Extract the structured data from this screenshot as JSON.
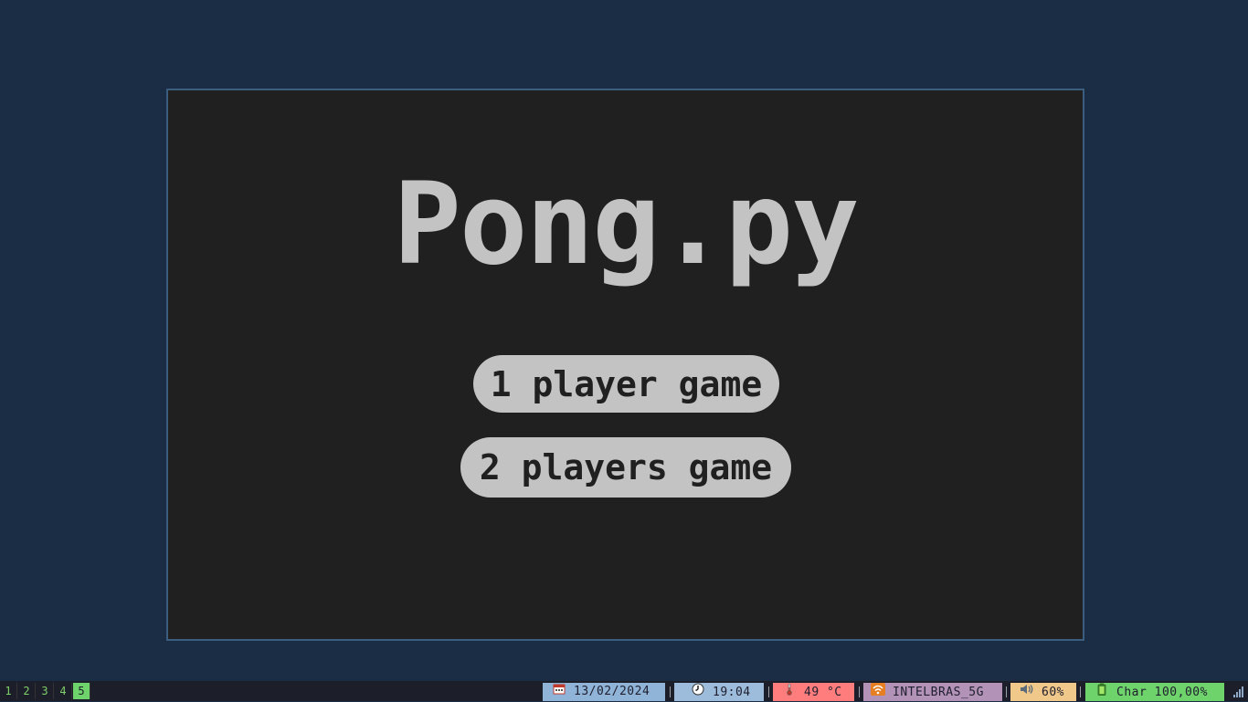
{
  "game": {
    "title": "Pong.py",
    "buttons": {
      "one_player": "1 player game",
      "two_players": "2 players game"
    }
  },
  "taskbar": {
    "workspaces": [
      "1",
      "2",
      "3",
      "4",
      "5"
    ],
    "active_workspace": "5",
    "status": {
      "date": "13/02/2024",
      "time": "19:04",
      "temperature": "49 °C",
      "wifi": "INTELBRAS_5G",
      "volume": "60%",
      "battery": "Char 100,00%"
    },
    "icons": {
      "date": "calendar-icon",
      "time": "clock-icon",
      "temperature": "thermometer-icon",
      "wifi": "wifi-icon",
      "volume": "speaker-icon",
      "battery": "battery-icon",
      "signal": "signal-bars-icon"
    }
  },
  "colors": {
    "desktop_bg": "#1a2d44",
    "window_bg": "#202020",
    "window_border": "#3a5d80",
    "title": "#c3c3c3",
    "button_bg": "#c3c3c3",
    "button_text": "#202020",
    "date_bg": "#90b4d8",
    "time_bg": "#9dbcdb",
    "temperature_bg": "#ff7d7d",
    "wifi_bg": "#b392b8",
    "volume_bg": "#f0c88a",
    "battery_bg": "#6fd36b",
    "active_workspace_bg": "#6fd36b"
  }
}
